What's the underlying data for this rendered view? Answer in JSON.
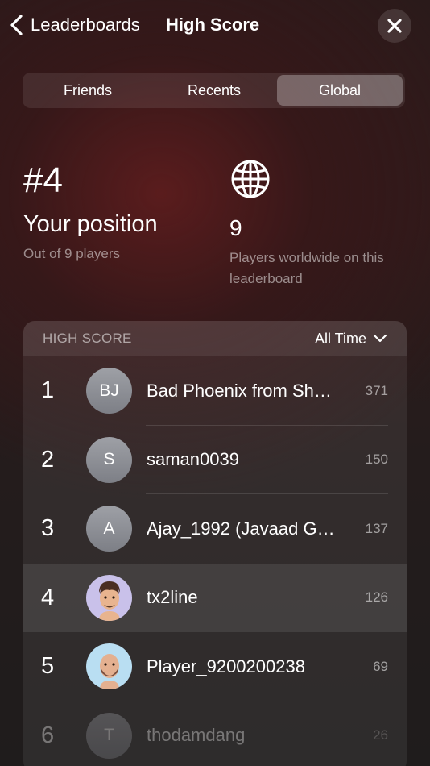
{
  "nav": {
    "back_label": "Leaderboards",
    "title": "High Score"
  },
  "tabs": [
    {
      "label": "Friends",
      "active": false
    },
    {
      "label": "Recents",
      "active": false
    },
    {
      "label": "Global",
      "active": true
    }
  ],
  "position": {
    "rank": "#4",
    "label": "Your position",
    "sub": "Out of 9 players"
  },
  "players": {
    "count": "9",
    "sub": "Players worldwide on this leaderboard"
  },
  "board": {
    "title": "HIGH SCORE",
    "time_filter": "All Time",
    "rows": [
      {
        "rank": "1",
        "initials": "BJ",
        "name": "Bad Phoenix from Sh…",
        "score": "371"
      },
      {
        "rank": "2",
        "initials": "S",
        "name": "saman0039",
        "score": "150"
      },
      {
        "rank": "3",
        "initials": "A",
        "name": "Ajay_1992 (Javaad G…",
        "score": "137"
      },
      {
        "rank": "4",
        "initials": "",
        "name": "tx2line",
        "score": "126"
      },
      {
        "rank": "5",
        "initials": "",
        "name": "Player_9200200238",
        "score": "69"
      },
      {
        "rank": "6",
        "initials": "T",
        "name": "thodamdang",
        "score": "26"
      }
    ]
  },
  "colors": {
    "background": "#2a1a1a",
    "accent_tab": "#6b5f5f"
  }
}
